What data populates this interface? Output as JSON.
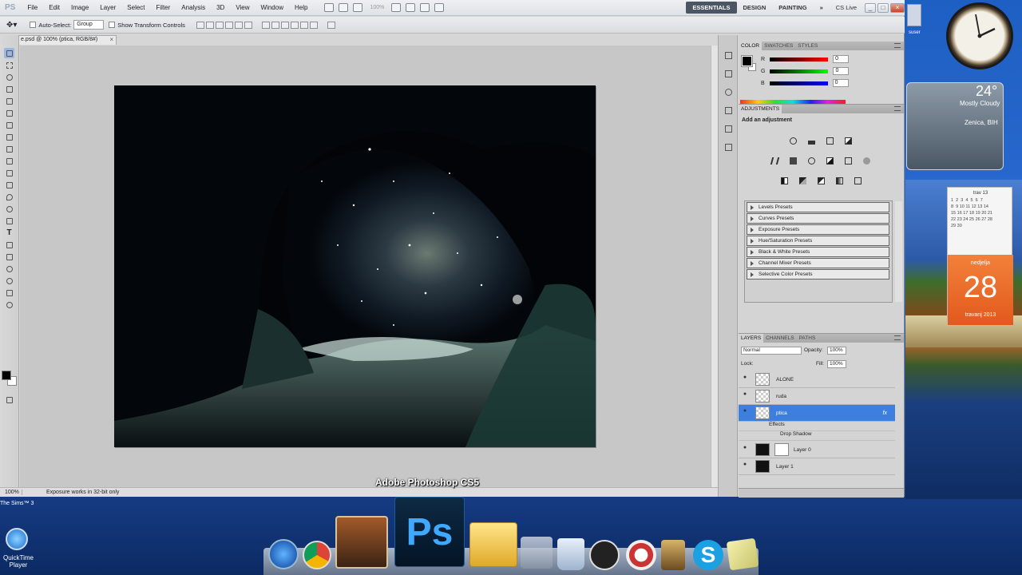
{
  "menubar": {
    "app_logo": "PS",
    "items": [
      "File",
      "Edit",
      "Image",
      "Layer",
      "Select",
      "Filter",
      "Analysis",
      "3D",
      "View",
      "Window",
      "Help"
    ],
    "zoom": "100%",
    "workspaces": [
      "ESSENTIALS",
      "DESIGN",
      "PAINTING"
    ],
    "more": "»",
    "cs_live": "CS Live"
  },
  "options": {
    "auto_select": "Auto-Select:",
    "auto_select_value": "Group",
    "show_transform": "Show Transform Controls"
  },
  "document": {
    "tab_title": "e.psd @ 100% (ptica, RGB/8#)",
    "tab_close": "×"
  },
  "status": {
    "zoom": "100%",
    "text": "Exposure works in 32-bit only"
  },
  "caption": "Adobe Photoshop CS5",
  "color_panel": {
    "tabs": [
      "COLOR",
      "SWATCHES",
      "STYLES"
    ],
    "channels": [
      {
        "label": "R",
        "value": "0",
        "color": "#e33"
      },
      {
        "label": "G",
        "value": "0",
        "color": "#3b3"
      },
      {
        "label": "B",
        "value": "0",
        "color": "#33d"
      }
    ]
  },
  "adjustments": {
    "title": "ADJUSTMENTS",
    "hint": "Add an adjustment",
    "presets": [
      "Levels Presets",
      "Curves Presets",
      "Exposure Presets",
      "Hue/Saturation Presets",
      "Black & White Presets",
      "Channel Mixer Presets",
      "Selective Color Presets"
    ]
  },
  "layers": {
    "tabs": [
      "LAYERS",
      "CHANNELS",
      "PATHS"
    ],
    "blend": "Normal",
    "opacity_label": "Opacity:",
    "opacity": "100%",
    "lock_label": "Lock:",
    "fill_label": "Fill:",
    "fill": "100%",
    "rows": [
      {
        "name": "ALONE"
      },
      {
        "name": "ruda"
      },
      {
        "name": "ptica",
        "fx": "fx"
      },
      {
        "name": "Layer 0"
      },
      {
        "name": "Layer 1"
      }
    ],
    "effects": "Effects",
    "drop_shadow": "Drop Shadow"
  },
  "desktop": {
    "user": "suser",
    "quicktime": "QuickTime Player",
    "sims": "The Sims™ 3"
  },
  "weather": {
    "temp": "24°",
    "desc": "Mostly Cloudy",
    "city": "Zenica, BIH"
  },
  "calendar": {
    "month": "trav 13",
    "weekday": "nedjelja",
    "date": "28",
    "month_full": "travanj 2013",
    "days": "1  2  3  4  5  6  7\n8  9 10 11 12 13 14\n15 16 17 18 19 20 21\n22 23 24 25 26 27 28\n29 30"
  }
}
